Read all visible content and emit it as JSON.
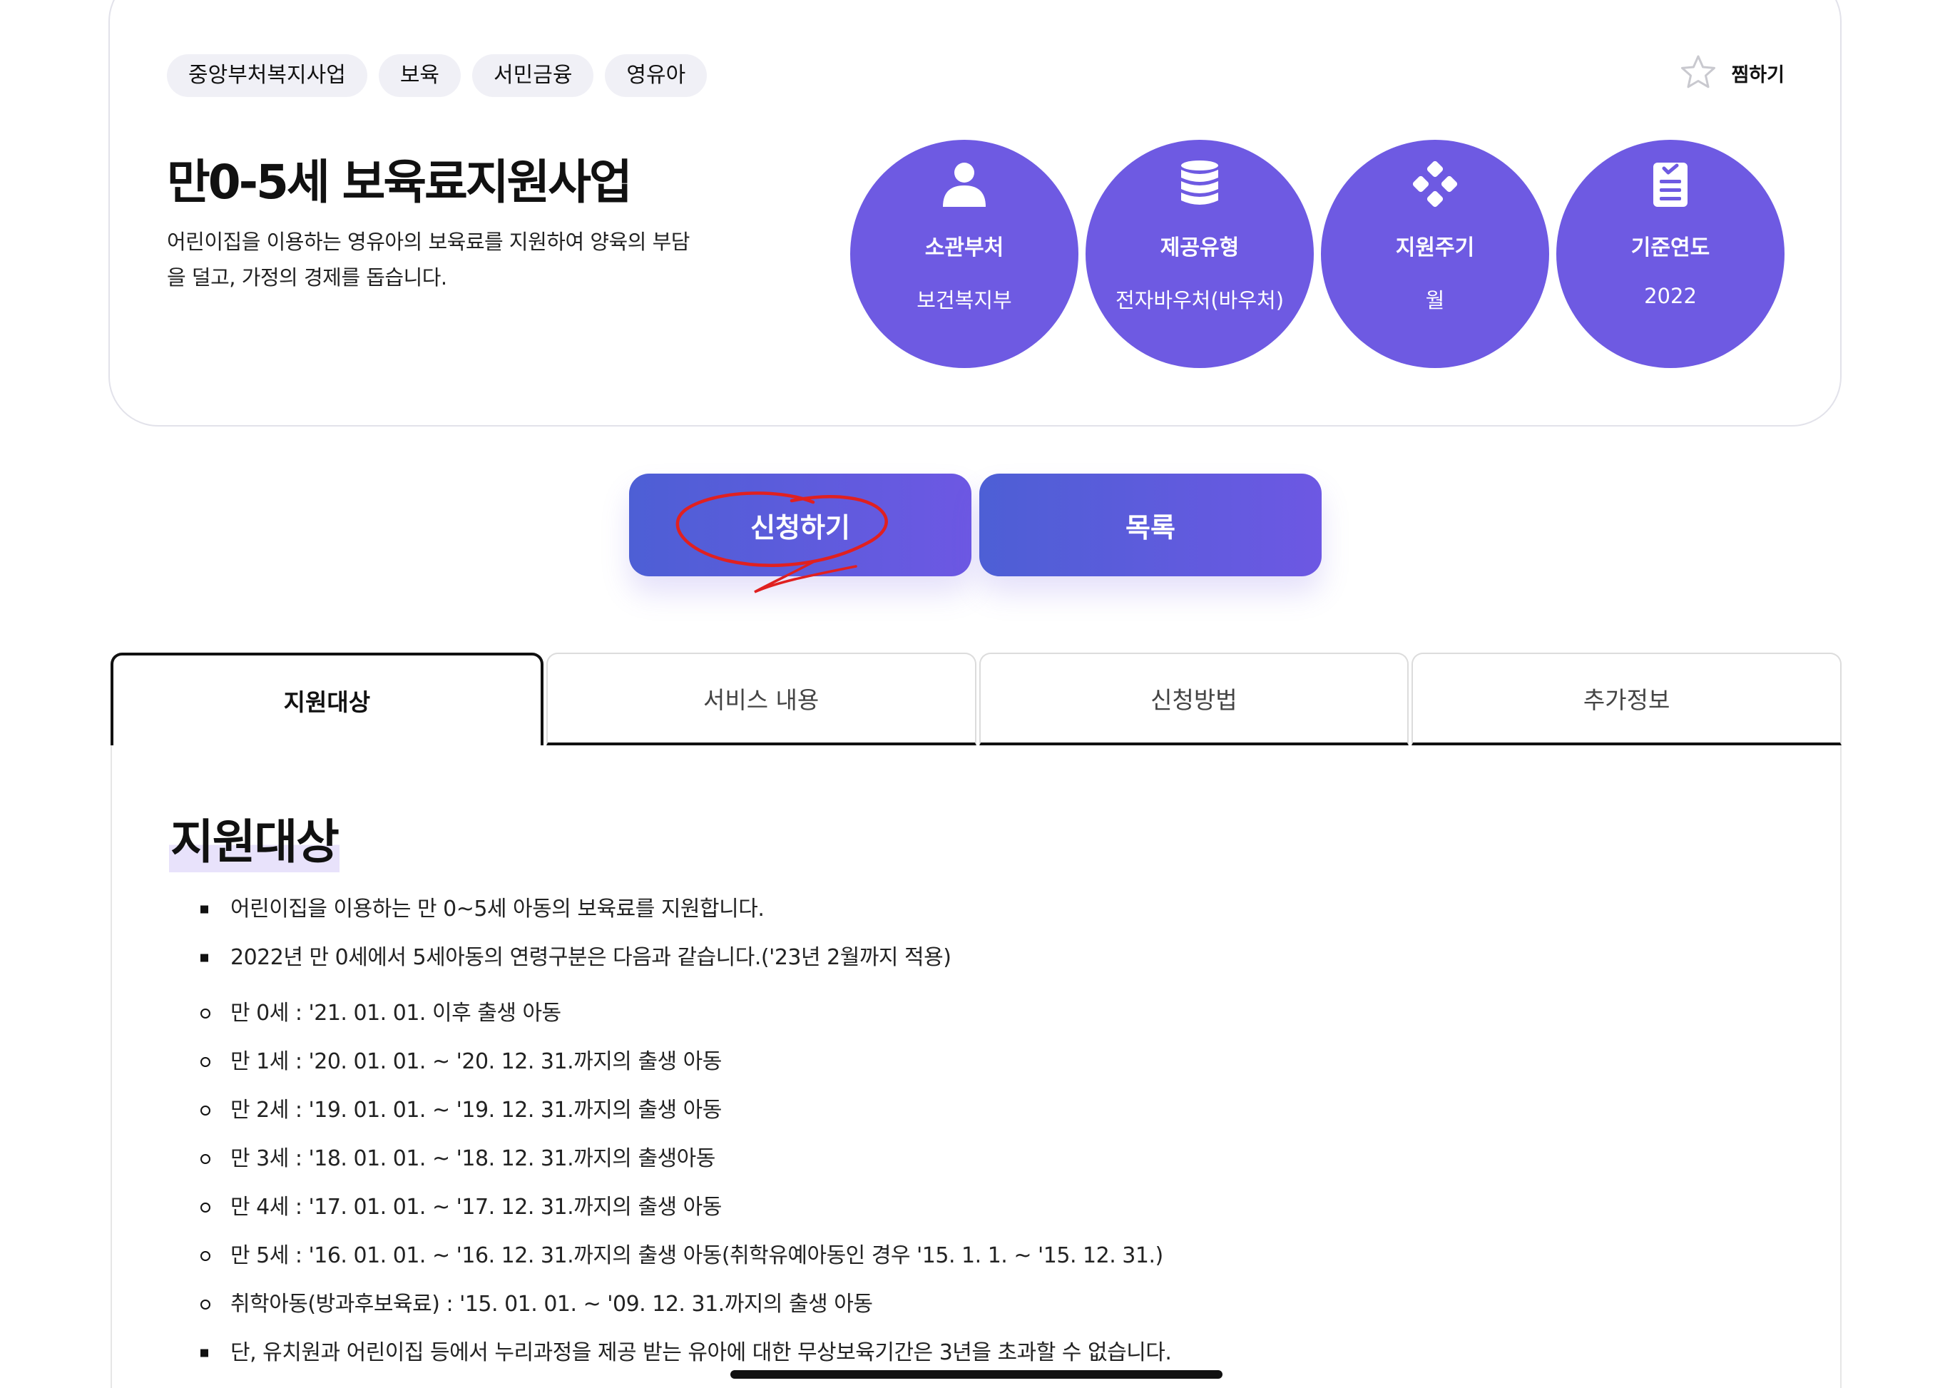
{
  "tags": [
    "중앙부처복지사업",
    "보육",
    "서민금융",
    "영유아"
  ],
  "favorite_label": "찜하기",
  "title": "만0-5세 보육료지원사업",
  "description": "어린이집을 이용하는 영유아의 보육료를 지원하여 양육의 부담을 덜고, 가정의 경제를 돕습니다.",
  "info": [
    {
      "label": "소관부처",
      "value": "보건복지부",
      "icon": "person-icon"
    },
    {
      "label": "제공유형",
      "value": "전자바우처(바우처)",
      "icon": "database-icon"
    },
    {
      "label": "지원주기",
      "value": "월",
      "icon": "diamond-cluster-icon"
    },
    {
      "label": "기준연도",
      "value": "2022",
      "icon": "clipboard-icon"
    }
  ],
  "buttons": {
    "apply": "신청하기",
    "list": "목록"
  },
  "tabs": [
    "지원대상",
    "서비스 내용",
    "신청방법",
    "추가정보"
  ],
  "active_tab": "지원대상",
  "section_title": "지원대상",
  "items": [
    {
      "type": "square",
      "text": "어린이집을 이용하는 만 0~5세 아동의 보육료를 지원합니다."
    },
    {
      "type": "square",
      "text": "2022년 만 0세에서 5세아동의 연령구분은 다음과 같습니다.('23년 2월까지 적용)"
    },
    {
      "type": "circle",
      "text": "만 0세 : '21. 01. 01. 이후 출생 아동"
    },
    {
      "type": "circle",
      "text": "만 1세 : '20. 01. 01. ~ '20. 12. 31.까지의 출생 아동"
    },
    {
      "type": "circle",
      "text": "만 2세 : '19. 01. 01. ~ '19. 12. 31.까지의 출생 아동"
    },
    {
      "type": "circle",
      "text": "만 3세 : '18. 01. 01. ~ '18. 12. 31.까지의 출생아동"
    },
    {
      "type": "circle",
      "text": "만 4세 : '17. 01. 01. ~ '17. 12. 31.까지의 출생 아동"
    },
    {
      "type": "circle",
      "text": "만 5세 : '16. 01. 01. ~ '16. 12. 31.까지의 출생 아동(취학유예아동인 경우 '15. 1. 1. ~ '15. 12. 31.)"
    },
    {
      "type": "circle",
      "text": "취학아동(방과후보육료) : '15. 01. 01. ~ '09. 12. 31.까지의 출생 아동"
    },
    {
      "type": "square",
      "text": "단, 유치원과 어린이집 등에서 누리과정을 제공 받는 유아에 대한 무상보육기간은 3년을 초과할 수 없습니다."
    }
  ],
  "colors": {
    "accent": "#6e5ae2",
    "button_gradient_start": "#4d5fd5",
    "annotation_red": "#e02020"
  }
}
